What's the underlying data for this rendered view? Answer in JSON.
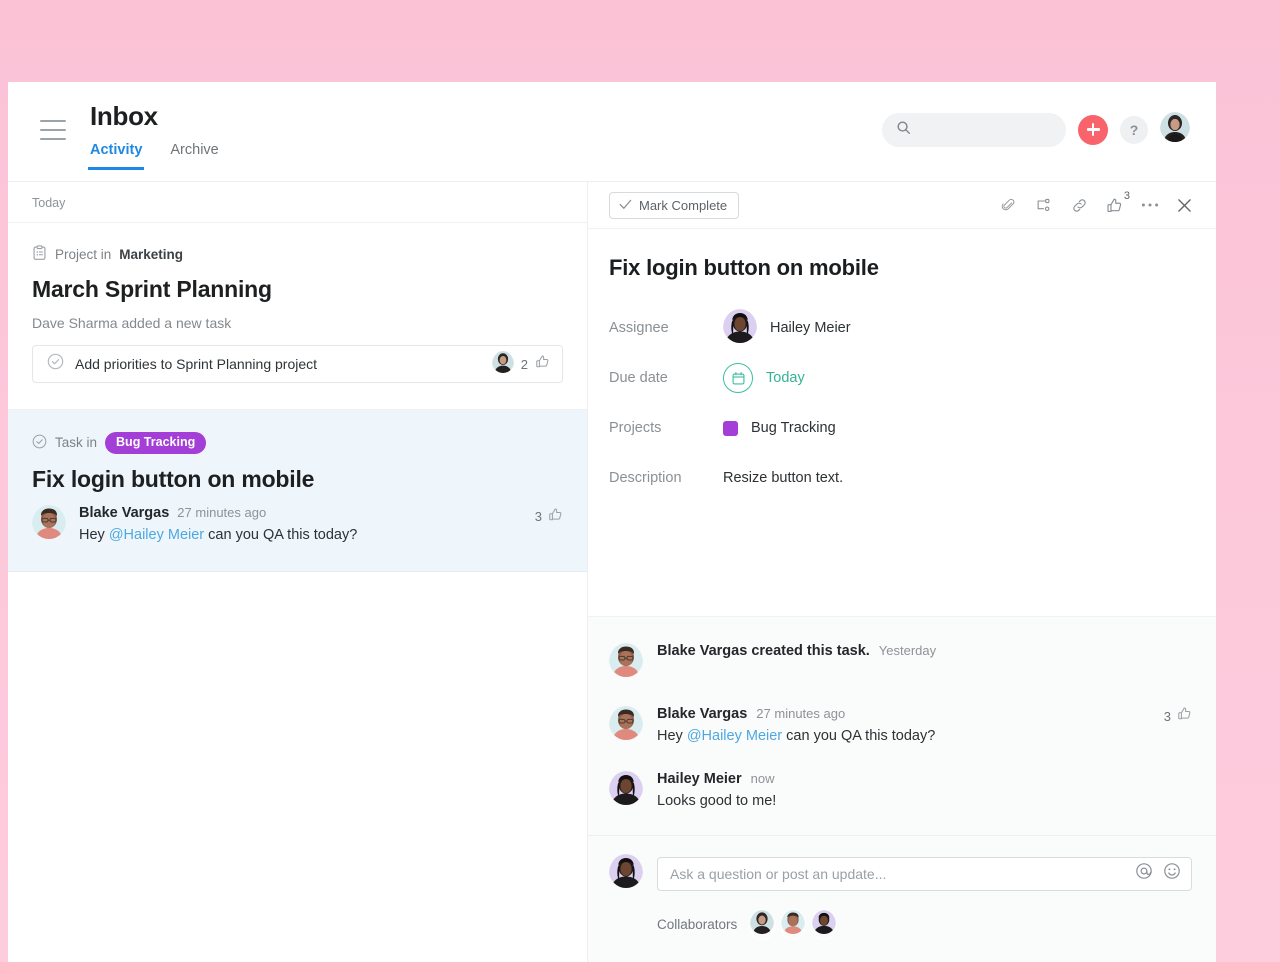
{
  "window": {
    "background_pink": "#fbc6d9",
    "accent_blue": "#1e88e5",
    "accent_red": "#f8636c",
    "accent_purple": "#a33ed6",
    "accent_teal": "#35b394",
    "selected_row_bg": "#eef6fb"
  },
  "header": {
    "title": "Inbox",
    "tabs": [
      {
        "label": "Activity",
        "active": true
      },
      {
        "label": "Archive",
        "active": false
      }
    ],
    "search": {
      "placeholder": "",
      "value": ""
    },
    "add_label": "+",
    "help_label": "?"
  },
  "inbox": {
    "day_header": "Today",
    "items": [
      {
        "context_icon": "project-icon",
        "context_prefix": "Project in",
        "context_target": "Marketing",
        "heading": "March Sprint Planning",
        "subtitle": "Dave Sharma added a new task",
        "task_card": {
          "title": "Add priorities to Sprint Planning project",
          "like_count": "2"
        }
      },
      {
        "context_icon": "task-icon",
        "context_prefix": "Task in",
        "context_chip": "Bug Tracking",
        "heading": "Fix login button on mobile",
        "comment": {
          "author": "Blake Vargas",
          "time": "27 minutes ago",
          "text_prefix": "Hey ",
          "mention": "@Hailey Meier",
          "text_suffix": " can you QA this today?",
          "like_count": "3"
        }
      }
    ]
  },
  "detail": {
    "mark_complete_label": "Mark Complete",
    "toolbar_icons": [
      {
        "name": "attachment-icon"
      },
      {
        "name": "subtask-icon"
      },
      {
        "name": "link-icon"
      },
      {
        "name": "like-icon",
        "badge": "3"
      },
      {
        "name": "more-icon"
      },
      {
        "name": "close-icon"
      }
    ],
    "title": "Fix login button on mobile",
    "fields": {
      "assignee_label": "Assignee",
      "assignee_value": "Hailey Meier",
      "due_date_label": "Due date",
      "due_date_value": "Today",
      "projects_label": "Projects",
      "projects_value": "Bug Tracking",
      "description_label": "Description",
      "description_value": "Resize button text."
    },
    "activity": [
      {
        "author": "Blake Vargas created this task.",
        "time": "Yesterday",
        "text": "",
        "like_count": ""
      },
      {
        "author": "Blake Vargas",
        "time": "27 minutes ago",
        "text_prefix": "Hey ",
        "mention": "@Hailey Meier",
        "text_suffix": " can you QA this today?",
        "like_count": "3"
      },
      {
        "author": "Hailey Meier",
        "time": "now",
        "text": "Looks good to me!",
        "like_count": ""
      }
    ],
    "composer": {
      "placeholder": "Ask a question or post an update...",
      "value": "",
      "mention_icon": "at-mention-icon",
      "emoji_icon": "emoji-icon"
    },
    "collaborators_label": "Collaborators"
  }
}
